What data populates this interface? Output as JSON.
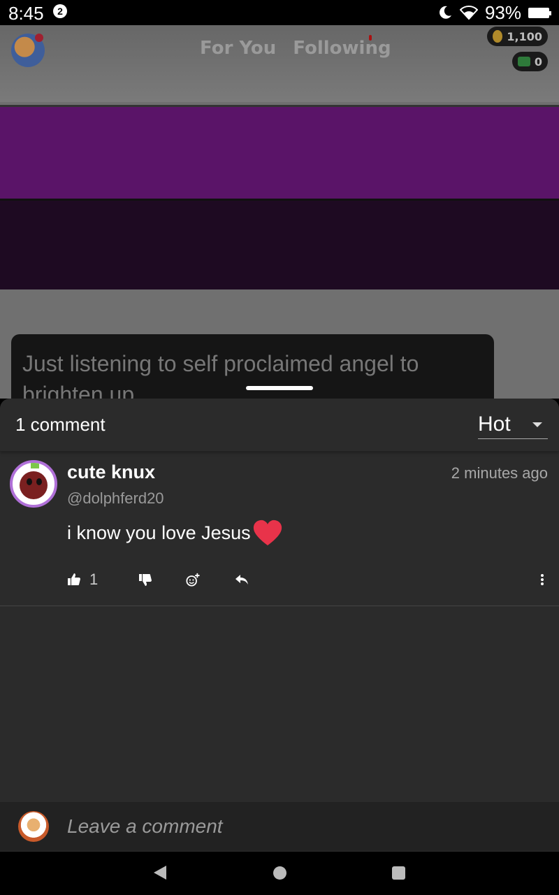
{
  "status_bar": {
    "time": "8:45",
    "notification_count": "2",
    "battery": "93%",
    "icons": [
      "moon-icon",
      "wifi-icon",
      "battery-icon"
    ]
  },
  "feed": {
    "tabs": [
      "For You",
      "Following"
    ],
    "coins": "1,100",
    "cash": "0",
    "post_caption": "Just listening to self proclaimed angel to brighten up"
  },
  "comments_sheet": {
    "count_label": "1 comment",
    "sort": {
      "selected": "Hot"
    },
    "comments": [
      {
        "display_name": "cute knux",
        "username": "@dolphferd20",
        "time": "2 minutes ago",
        "text": "i know you love Jesus",
        "emoji": "heart-icon",
        "likes": "1"
      }
    ],
    "composer": {
      "placeholder": "Leave a comment"
    }
  },
  "colors": {
    "sheet_bg": "#2b2b2b",
    "purple_band": "#5a1468",
    "heart": "#e8334a",
    "avatar_ring": "#b070d8"
  }
}
